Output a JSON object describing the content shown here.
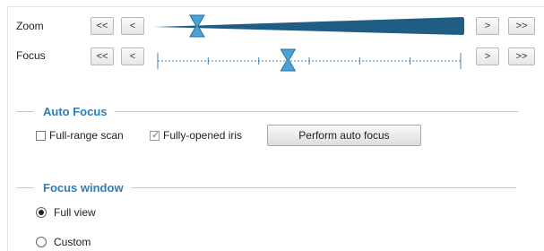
{
  "zoom": {
    "label": "Zoom",
    "buttons": {
      "fast_back": "<<",
      "back": "<",
      "forward": ">",
      "fast_forward": ">>"
    },
    "value": 0.13
  },
  "focus": {
    "label": "Focus",
    "buttons": {
      "fast_back": "<<",
      "back": "<",
      "forward": ">",
      "fast_forward": ">>"
    },
    "value": 0.43
  },
  "auto_focus": {
    "title": "Auto Focus",
    "full_range_scan": {
      "label": "Full-range scan",
      "checked": false
    },
    "fully_opened_iris": {
      "label": "Fully-opened iris",
      "checked": true
    },
    "perform_button": "Perform auto focus"
  },
  "focus_window": {
    "title": "Focus window",
    "options": [
      {
        "label": "Full view",
        "selected": true
      },
      {
        "label": "Custom",
        "selected": false
      }
    ]
  },
  "colors": {
    "accent": "#2b7fb8",
    "slider_fill": "#1f5d85",
    "handle": "#4aa3d8"
  }
}
